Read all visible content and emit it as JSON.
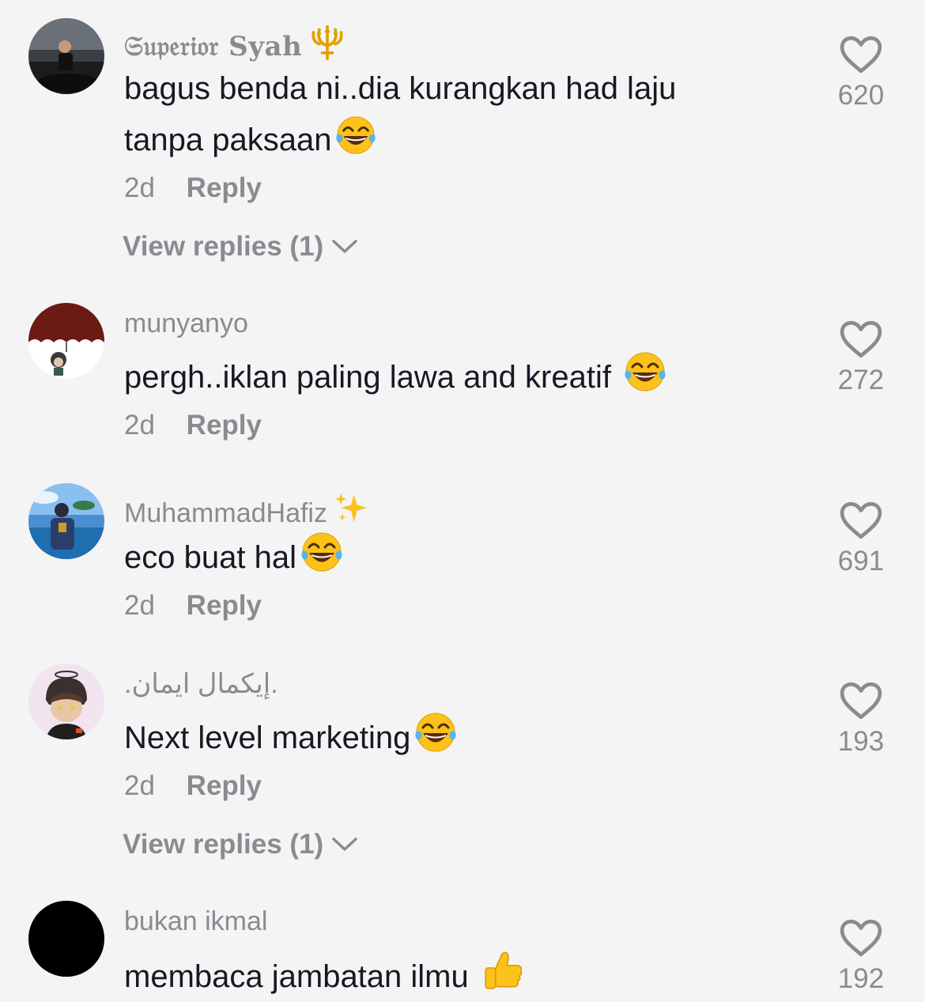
{
  "comments": [
    {
      "username": "𝔖𝔲𝔭𝔢𝔯𝔦𝔬𝔯 Syah",
      "name_icon": "trident-icon",
      "text": "bagus benda ni..dia kurangkan had laju tanpa paksaan",
      "emoji": "laughing-tears-emoji",
      "time": "2d",
      "reply_label": "Reply",
      "view_replies": "View replies (1)",
      "likes": "620"
    },
    {
      "username": "munyanyo",
      "text": "pergh..iklan paling lawa and kreatif",
      "emoji": "laughing-tears-emoji",
      "time": "2d",
      "reply_label": "Reply",
      "likes": "272"
    },
    {
      "username": "MuhammadHafiz",
      "name_icon": "sparkles-icon",
      "text": "eco buat hal",
      "emoji": "laughing-tears-emoji",
      "time": "2d",
      "reply_label": "Reply",
      "likes": "691"
    },
    {
      "username": ".إيكمال ايمان.",
      "text": "Next level marketing",
      "emoji": "laughing-tears-emoji",
      "time": "2d",
      "reply_label": "Reply",
      "view_replies": "View replies (1)",
      "likes": "193"
    },
    {
      "username": "bukan ikmal",
      "text": "membaca jambatan ilmu",
      "emoji": "thumbs-up-emoji",
      "likes": "192"
    }
  ],
  "colors": {
    "background": "#f4f4f5",
    "text_primary": "#161823",
    "text_secondary": "#8a8b91"
  }
}
